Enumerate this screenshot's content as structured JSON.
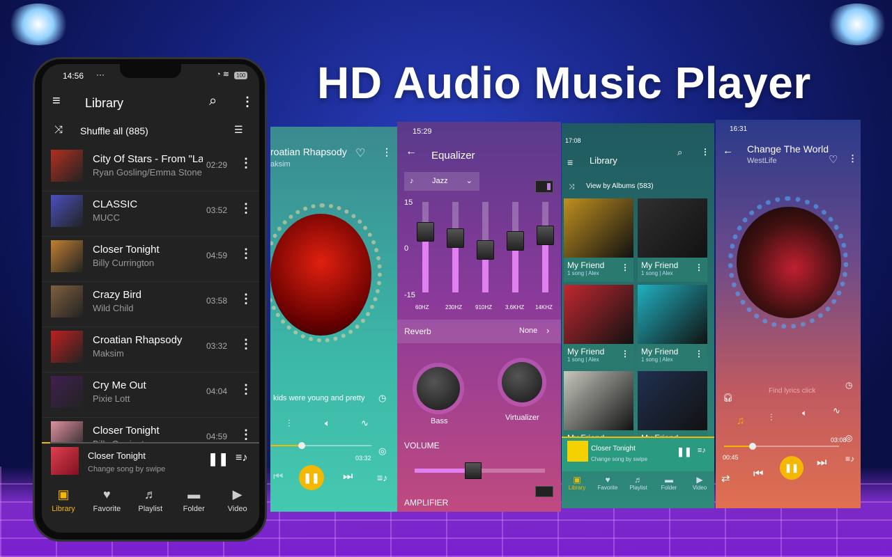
{
  "headline": "HD Audio Music Player",
  "colors": {
    "accent": "#f5b800",
    "left_bg": "#222222",
    "eq_purple": "#7a3c9a",
    "eq_pink": "#c04a80",
    "library_green": "#2f8a7a",
    "player_red": "#d9655a",
    "teal": "#3fb5a8"
  },
  "phone_main": {
    "status": {
      "time": "14:56",
      "dots": "···",
      "battery": "100"
    },
    "header": {
      "title": "Library",
      "menu_icon": "hamburger-icon",
      "search_icon": "search-icon",
      "more_icon": "more-vert-icon"
    },
    "shuffle": {
      "label": "Shuffle all  (885)",
      "icon": "shuffle-icon",
      "sort_icon": "sort-view-icon"
    },
    "songs": [
      {
        "title": "City Of Stars - From \"La",
        "artist": "Ryan Gosling/Emma Stone",
        "duration": "02:29",
        "art": "#b03020"
      },
      {
        "title": "CLASSIC",
        "artist": "MUCC",
        "duration": "03:52",
        "art": "#4a50c0"
      },
      {
        "title": "Closer Tonight",
        "artist": "Billy Currington",
        "duration": "04:59",
        "art": "#c08030"
      },
      {
        "title": "Crazy Bird",
        "artist": "Wild Child",
        "duration": "03:58",
        "art": "#806040"
      },
      {
        "title": "Croatian Rhapsody",
        "artist": "Maksim",
        "duration": "03:32",
        "art": "#c02020"
      },
      {
        "title": "Cry Me Out",
        "artist": "Pixie Lott",
        "duration": "04:04",
        "art": "#402050"
      },
      {
        "title": "Closer Tonight",
        "artist": "Billy Currington",
        "duration": "04:59",
        "art": "#e090a0"
      }
    ],
    "mini_player": {
      "title": "Closer Tonight",
      "subtitle": "Change song by swipe"
    },
    "nav": [
      {
        "label": "Library",
        "active": true
      },
      {
        "label": "Favorite"
      },
      {
        "label": "Playlist"
      },
      {
        "label": "Folder"
      },
      {
        "label": "Video"
      }
    ]
  },
  "panel_player1": {
    "title": "roatian Rhapsody",
    "artist": "aksim",
    "lyrics": "kids were young and pretty",
    "time_end": "03:32"
  },
  "panel_equalizer": {
    "time": "15:29",
    "title": "Equalizer",
    "preset": "Jazz",
    "scale": [
      "15",
      "0",
      "-15"
    ],
    "bands": [
      {
        "label": "60HZ",
        "value": 5
      },
      {
        "label": "230HZ",
        "value": 3
      },
      {
        "label": "910HZ",
        "value": -1
      },
      {
        "label": "3.6KHZ",
        "value": 2
      },
      {
        "label": "14KHZ",
        "value": 4
      }
    ],
    "reverb": {
      "label": "Reverb",
      "value": "None"
    },
    "knobs": [
      "Bass",
      "Virtualizer"
    ],
    "volume_label": "VOLUME",
    "volume": 0.45,
    "amplifier_label": "AMPLIFIER"
  },
  "panel_library": {
    "time": "17:08",
    "title": "Library",
    "view": "View by Albums  (583)",
    "albums": [
      {
        "name": "My Friend",
        "meta": "1 song | Alex",
        "c": "#c09020"
      },
      {
        "name": "My Friend",
        "meta": "1 song | Alex",
        "c": "#303030"
      },
      {
        "name": "My Friend",
        "meta": "1 song | Alex",
        "c": "#c02830"
      },
      {
        "name": "My Friend",
        "meta": "1 song | Alex",
        "c": "#20b0c0"
      },
      {
        "name": "My Friend",
        "meta": "",
        "c": "#c8c8c0"
      },
      {
        "name": "My Friend",
        "meta": "",
        "c": "#203050"
      }
    ],
    "mini_player": {
      "title": "Closer Tonight",
      "subtitle": "Change song by swipe"
    },
    "nav": [
      "Library",
      "Favorite",
      "Playlist",
      "Folder",
      "Video"
    ]
  },
  "panel_player2": {
    "time": "16:31",
    "title": "Change The World",
    "artist": "WestLife",
    "lyrics": "Find lyrics click",
    "time_start": "00:45",
    "time_end": "03:08",
    "progress": 0.25
  }
}
